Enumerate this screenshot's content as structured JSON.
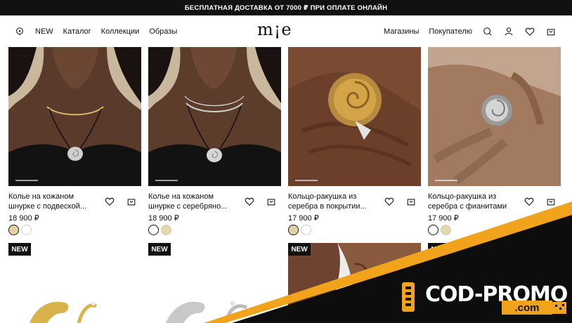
{
  "topbar": {
    "text": "БЕСПЛАТНАЯ ДОСТАВКА ОТ 7000 ₽ ПРИ ОПЛАТЕ ОНЛАЙН"
  },
  "header": {
    "logo": "m¡e",
    "nav_left": [
      "NEW",
      "Каталог",
      "Коллекции",
      "Образы"
    ],
    "nav_right": [
      "Магазины",
      "Покупателю"
    ],
    "icons": [
      "location-icon",
      "search-icon",
      "user-icon",
      "heart-icon",
      "cart-icon"
    ]
  },
  "products": [
    {
      "title": "Колье на кожаном шнурке с подвеской...",
      "price": "18 900 ₽",
      "swatches": [
        "gold",
        "silver"
      ],
      "selected": 0
    },
    {
      "title": "Колье на кожаном шнурке с серебряно...",
      "price": "18 900 ₽",
      "swatches": [
        "silver",
        "gold"
      ],
      "selected": 0
    },
    {
      "title": "Кольцо-ракушка из серебра в покрытии...",
      "price": "17 900 ₽",
      "swatches": [
        "gold",
        "silver"
      ],
      "selected": 0
    },
    {
      "title": "Кольцо-ракушка из серебра с фианитами",
      "price": "17 900 ₽",
      "swatches": [
        "silver",
        "gold"
      ],
      "selected": 0
    }
  ],
  "badges": [
    "NEW",
    "NEW",
    "NEW",
    "NEW"
  ],
  "promo": {
    "main": "COD-PROMO",
    "suffix": ".com"
  },
  "colors": {
    "accent": "#f2a31c",
    "dark": "#111111"
  }
}
